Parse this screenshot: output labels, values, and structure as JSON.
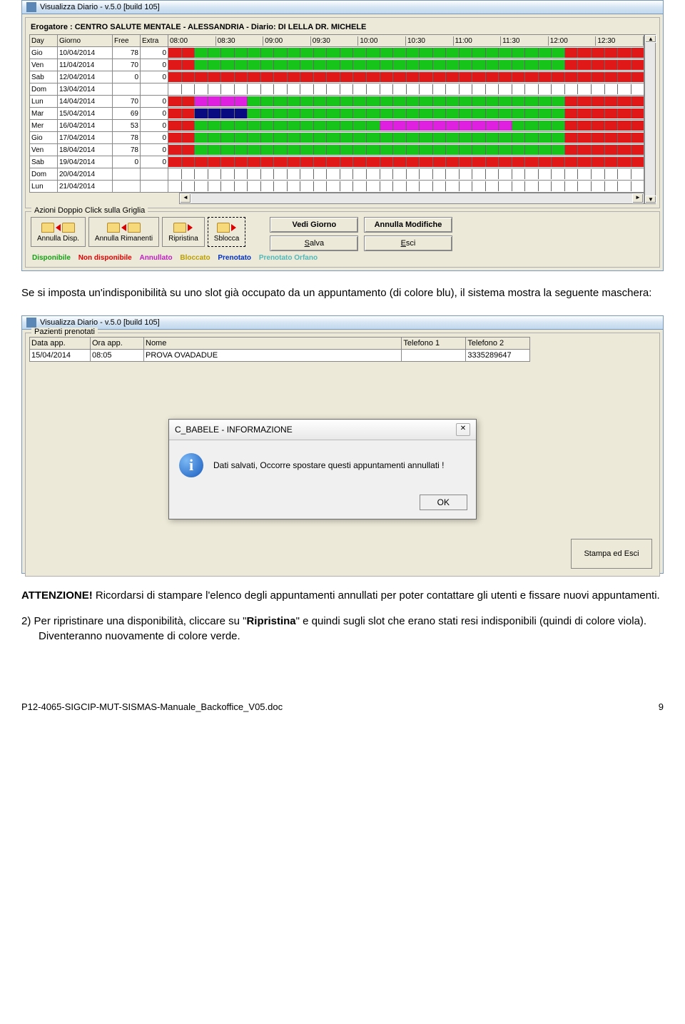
{
  "win1": {
    "title": "Visualizza Diario - v.5.0 [build 105]",
    "header": "Erogatore : CENTRO SALUTE MENTALE - ALESSANDRIA  -  Diario: DI LELLA DR. MICHELE",
    "cols_left": [
      "Day",
      "Giorno",
      "Free",
      "Extra"
    ],
    "times": [
      "08:00",
      "08:30",
      "09:00",
      "09:30",
      "10:00",
      "10:30",
      "11:00",
      "11:30",
      "12:00",
      "12:30"
    ],
    "rows": [
      {
        "d": "Gio",
        "g": "10/04/2014",
        "f": "78",
        "e": "0",
        "slots": "rrggggggggggggggggggggggggggggrrrrrr"
      },
      {
        "d": "Ven",
        "g": "11/04/2014",
        "f": "70",
        "e": "0",
        "slots": "rrggggggggggggggggggggggggggggrrrrrr"
      },
      {
        "d": "Sab",
        "g": "12/04/2014",
        "f": "0",
        "e": "0",
        "slots": "rrrrrrrrrrrrrrrrrrrrrrrrrrrrrrrrrrrr"
      },
      {
        "d": "Dom",
        "g": "13/04/2014",
        "f": "",
        "e": "",
        "slots": "wwwwwwwwwwwwwwwwwwwwwwwwwwwwwwwwwwww"
      },
      {
        "d": "Lun",
        "g": "14/04/2014",
        "f": "70",
        "e": "0",
        "slots": "rrmmmmggggggggggggggggggggggggrrrrrr"
      },
      {
        "d": "Mar",
        "g": "15/04/2014",
        "f": "69",
        "e": "0",
        "slots": "rrbbbbggggggggggggggggggggggggrrrrrr"
      },
      {
        "d": "Mer",
        "g": "16/04/2014",
        "f": "53",
        "e": "0",
        "slots": "rrggggggggggggggmmmmmmmmmmggggrrrrrr"
      },
      {
        "d": "Gio",
        "g": "17/04/2014",
        "f": "78",
        "e": "0",
        "slots": "rrggggggggggggggggggggggggggggrrrrrr"
      },
      {
        "d": "Ven",
        "g": "18/04/2014",
        "f": "78",
        "e": "0",
        "slots": "rrggggggggggggggggggggggggggggrrrrrr"
      },
      {
        "d": "Sab",
        "g": "19/04/2014",
        "f": "0",
        "e": "0",
        "slots": "rrrrrrrrrrrrrrrrrrrrrrrrrrrrrrrrrrrr"
      },
      {
        "d": "Dom",
        "g": "20/04/2014",
        "f": "",
        "e": "",
        "slots": "wwwwwwwwwwwwwwwwwwwwwwwwwwwwwwwwwwww"
      },
      {
        "d": "Lun",
        "g": "21/04/2014",
        "f": "",
        "e": "",
        "slots": "wwwwwwwwwwwwwwwwwwwwwwwwwwwwwwwwwwww"
      }
    ],
    "actions_legend": "Azioni Doppio Click sulla Griglia",
    "actions": [
      "Annulla Disp.",
      "Annulla Rimanenti",
      "Ripristina",
      "Sblocca"
    ],
    "buttons": {
      "vedi": "Vedi Giorno",
      "annulla": "Annulla Modifiche",
      "salva": "Salva",
      "esci": "Esci"
    },
    "status": {
      "disp": "Disponibile",
      "nondisp": "Non disponibile",
      "ann": "Annullato",
      "bloc": "Bloccato",
      "pren": "Prenotato",
      "orf": "Prenotato Orfano"
    }
  },
  "txt1": "Se si imposta un'indisponibilità su uno slot già occupato da un appuntamento (di colore blu), il sistema mostra la seguente maschera:",
  "win2": {
    "title": "Visualizza Diario - v.5.0 [build 105]",
    "legend": "Pazienti prenotati",
    "cols": [
      "Data app.",
      "Ora app.",
      "Nome",
      "Telefono 1",
      "Telefono 2"
    ],
    "row": {
      "data": "15/04/2014",
      "ora": "08:05",
      "nome": "PROVA OVADADUE",
      "tel1": "",
      "tel2": "3335289647"
    },
    "dialog": {
      "title": "C_BABELE - INFORMAZIONE",
      "msg": "Dati salvati, Occorre spostare questi appuntamenti annullati !",
      "ok": "OK"
    },
    "stampa": "Stampa ed Esci"
  },
  "txt2a": "ATTENZIONE!",
  "txt2b": " Ricordarsi di stampare l'elenco degli appuntamenti annullati per poter contattare gli utenti e fissare nuovi appuntamenti.",
  "txt3a": "2)   Per ripristinare una disponibilità, cliccare su \"",
  "txt3b": "Ripristina",
  "txt3c": "\" e quindi sugli slot che erano stati resi indisponibili (quindi di colore viola). Diventeranno nuovamente di colore verde.",
  "footer": {
    "left": "P12-4065-SIGCIP-MUT-SISMAS-Manuale_Backoffice_V05.doc",
    "right": "9"
  }
}
